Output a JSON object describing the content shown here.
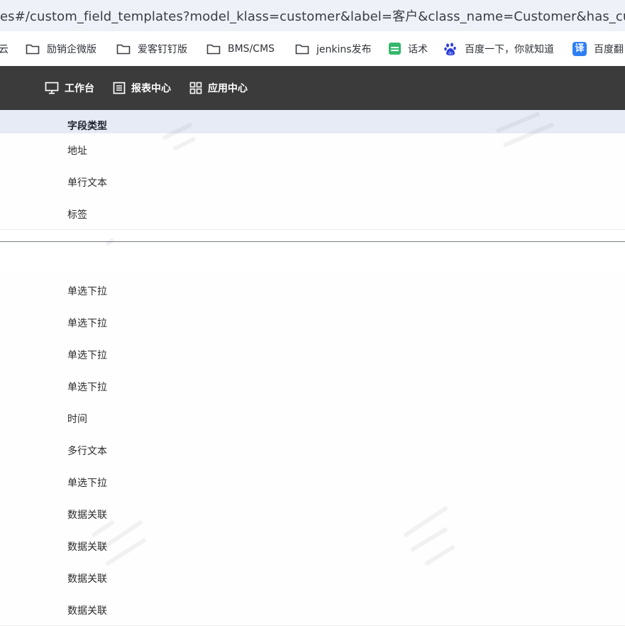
{
  "browser": {
    "url": "es#/custom_field_templates?model_klass=customer&label=客户&class_name=Customer&has_custom_fie"
  },
  "bookmarks": [
    {
      "label": "云",
      "icon": "none"
    },
    {
      "label": "励销企微版",
      "icon": "folder-icon"
    },
    {
      "label": "爱客钉钉版",
      "icon": "folder-icon"
    },
    {
      "label": "BMS/CMS",
      "icon": "folder-icon"
    },
    {
      "label": "jenkins发布",
      "icon": "folder-icon"
    },
    {
      "label": "话术",
      "icon": "sheet-icon"
    },
    {
      "label": "百度一下，你就知道",
      "icon": "baidu-paw-icon"
    },
    {
      "label": "百度翻",
      "icon": "translate-icon",
      "badge": "译"
    }
  ],
  "header": {
    "nav": [
      {
        "label": "工作台",
        "icon": "monitor-icon"
      },
      {
        "label": "报表中心",
        "icon": "report-icon"
      },
      {
        "label": "应用中心",
        "icon": "grid-icon"
      }
    ]
  },
  "table": {
    "column_header": "字段类型",
    "group1": [
      "地址",
      "单行文本",
      "标签"
    ],
    "group2": [
      "",
      "单选下拉",
      "单选下拉",
      "单选下拉",
      "单选下拉",
      "时间",
      "多行文本",
      "单选下拉",
      "数据关联",
      "数据关联",
      "数据关联",
      "数据关联"
    ]
  },
  "colors": {
    "header_bg": "#3b3b3b",
    "table_header_bg": "#e7ebf6",
    "urlbar_bg": "#eef1f7"
  }
}
